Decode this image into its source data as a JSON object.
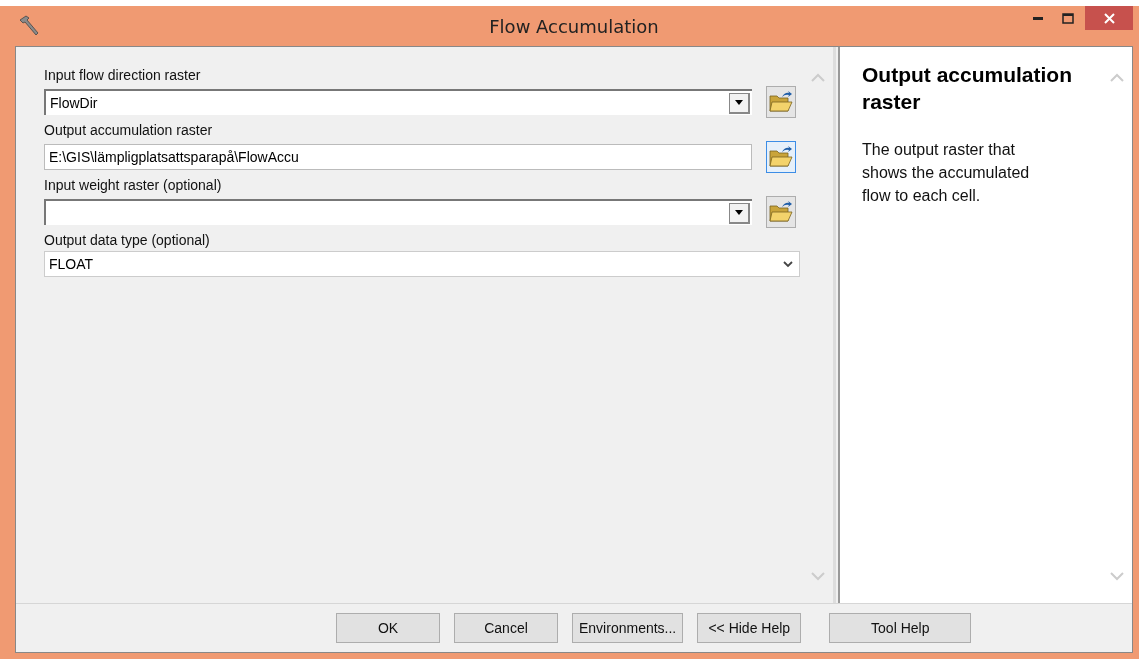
{
  "window": {
    "title": "Flow Accumulation"
  },
  "parameters": [
    {
      "label": "Input flow direction raster",
      "kind": "combo",
      "value": "FlowDir",
      "browse_focused": false
    },
    {
      "label": "Output accumulation raster",
      "kind": "text",
      "value": "E:\\GIS\\lämpligplatsattsparapå\\FlowAccu",
      "browse_focused": true
    },
    {
      "label": "Input weight raster (optional)",
      "kind": "combo",
      "browse_focused": false
    },
    {
      "label": "Output data type (optional)",
      "kind": "select",
      "value": "FLOAT"
    }
  ],
  "help": {
    "title": "Output accumulation raster",
    "text": "The output raster that shows the accumulated flow to each cell."
  },
  "buttons": [
    {
      "label": "OK",
      "kind": "action"
    },
    {
      "label": "Cancel",
      "kind": "action"
    },
    {
      "label": "Environments...",
      "kind": "action"
    },
    {
      "label": "<< Hide Help",
      "kind": "action"
    },
    {
      "label": "Tool Help",
      "kind": "separate"
    }
  ]
}
